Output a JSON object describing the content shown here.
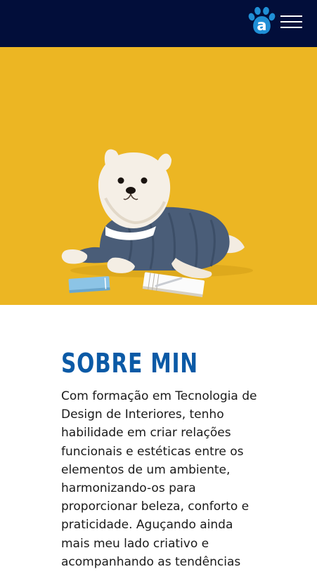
{
  "header": {
    "logo_icon": "paw-logo-icon",
    "logo_letter": "a",
    "menu_icon": "hamburger-menu-icon",
    "background": "#020e3a"
  },
  "hero": {
    "background": "#ecb623"
  },
  "about": {
    "title": "SOBRE MIN",
    "title_color": "#0b5aa6",
    "text": "Com formação em Tecnologia de Design de Interiores, tenho habilidade em criar relações funcionais e estéticas entre os elementos de um ambiente, harmonizando-os para proporcionar beleza, conforto e praticidade. Aguçando ainda mais meu lado criativo e acompanhando as tendências"
  }
}
